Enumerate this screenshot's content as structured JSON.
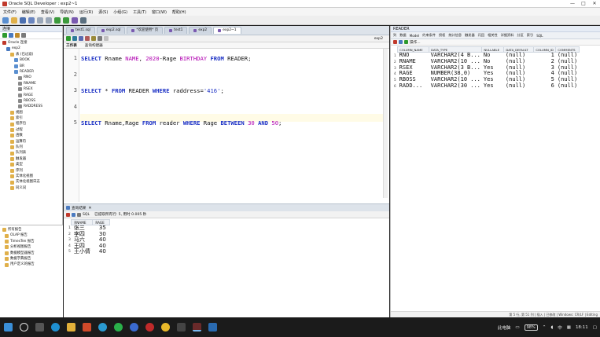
{
  "window": {
    "title": "Oracle SQL Developer : exp2~1",
    "controls": [
      "—",
      "□",
      "✕"
    ]
  },
  "menu": [
    "文件(F)",
    "编辑(E)",
    "查看(V)",
    "导航(N)",
    "运行(R)",
    "源(S)",
    "小组(G)",
    "工具(T)",
    "窗口(W)",
    "帮助(H)"
  ],
  "left_panel": {
    "title": "连接",
    "tree": [
      {
        "label": "Oracle 连接",
        "depth": 0
      },
      {
        "label": "exp2",
        "depth": 1
      },
      {
        "label": "表 (已过滤)",
        "depth": 2
      },
      {
        "label": "BOOK",
        "depth": 3
      },
      {
        "label": "BR",
        "depth": 3
      },
      {
        "label": "READER",
        "depth": 3
      },
      {
        "label": "RNO",
        "depth": 4
      },
      {
        "label": "RNAME",
        "depth": 4
      },
      {
        "label": "RSEX",
        "depth": 4
      },
      {
        "label": "RAGE",
        "depth": 4
      },
      {
        "label": "RBOSS",
        "depth": 4
      },
      {
        "label": "RADDRESS",
        "depth": 4
      },
      {
        "label": "视图",
        "depth": 2
      },
      {
        "label": "索引",
        "depth": 2
      },
      {
        "label": "程序包",
        "depth": 2
      },
      {
        "label": "过程",
        "depth": 2
      },
      {
        "label": "函数",
        "depth": 2
      },
      {
        "label": "运算符",
        "depth": 2
      },
      {
        "label": "队列",
        "depth": 2
      },
      {
        "label": "队列表",
        "depth": 2
      },
      {
        "label": "触发器",
        "depth": 2
      },
      {
        "label": "类型",
        "depth": 2
      },
      {
        "label": "序列",
        "depth": 2
      },
      {
        "label": "实体化视图",
        "depth": 2
      },
      {
        "label": "实体化视图日志",
        "depth": 2
      },
      {
        "label": "同义词",
        "depth": 2
      }
    ]
  },
  "reports_panel": {
    "items": [
      "所有报告",
      "OLAP 报告",
      "TimesTen 报告",
      "分析视图报告",
      "数据模型器报告",
      "数据字典报告",
      "用户定义的报告"
    ]
  },
  "editor": {
    "tabs": [
      "test1.sql",
      "exp2.sql",
      "*欢迎使用* 页",
      "test1",
      "exp2",
      "exp2~1"
    ],
    "active_tab": "exp2~1",
    "connection": "exp2",
    "subtabs": [
      "工作表",
      "查询构建器"
    ],
    "lines": [
      {
        "n": "1",
        "tokens": [
          [
            "kw",
            "SELECT"
          ],
          [
            "t",
            " Rname "
          ],
          [
            "num",
            "NAME"
          ],
          [
            "t",
            ", "
          ],
          [
            "num",
            "2020"
          ],
          [
            "t",
            "-Rage "
          ],
          [
            "num",
            "BIRTHDAY"
          ],
          [
            "t",
            " "
          ],
          [
            "kw",
            "FROM"
          ],
          [
            "t",
            " READER;"
          ]
        ]
      },
      {
        "n": "2",
        "tokens": []
      },
      {
        "n": "3",
        "tokens": [
          [
            "kw",
            "SELECT"
          ],
          [
            "t",
            " * "
          ],
          [
            "kw",
            "FROM"
          ],
          [
            "t",
            " READER "
          ],
          [
            "kw",
            "WHERE"
          ],
          [
            "t",
            " raddress="
          ],
          [
            "str",
            "'416'"
          ],
          [
            "t",
            ";"
          ]
        ]
      },
      {
        "n": "4",
        "tokens": []
      },
      {
        "n": "5",
        "tokens": [
          [
            "kw",
            "SELECT"
          ],
          [
            "t",
            " Rname,Rage "
          ],
          [
            "kw",
            "FROM"
          ],
          [
            "t",
            " reader "
          ],
          [
            "kw",
            "WHERE"
          ],
          [
            "t",
            " Rage "
          ],
          [
            "kw",
            "BETWEEN"
          ],
          [
            "t",
            " "
          ],
          [
            "num",
            "30"
          ],
          [
            "t",
            " "
          ],
          [
            "kw",
            "AND"
          ],
          [
            "t",
            " "
          ],
          [
            "num",
            "50"
          ],
          [
            "t",
            ";"
          ]
        ]
      }
    ]
  },
  "results": {
    "tab": "查询结果",
    "status": "已提取所有行: 5, 用时 0.005 秒",
    "sql_label": "SQL",
    "columns": [
      "RNAME",
      "RAGE"
    ],
    "rows": [
      {
        "rn": "1",
        "name": "张三",
        "age": "35"
      },
      {
        "rn": "2",
        "name": "李四",
        "age": "30"
      },
      {
        "rn": "3",
        "name": "马六",
        "age": "40"
      },
      {
        "rn": "4",
        "name": "王四",
        "age": "40"
      },
      {
        "rn": "5",
        "name": "王小倩",
        "age": "40"
      }
    ]
  },
  "right_panel": {
    "title": "READER",
    "tabs": [
      "列",
      "数据",
      "Model",
      "约束条件",
      "授权",
      "统计信息",
      "触发器",
      "闪回",
      "相关性",
      "详细资料",
      "分区",
      "索引",
      "SQL"
    ],
    "action": "操作...",
    "columns": [
      "COLUMN_NAME",
      "DATA_TYPE",
      "NULLABLE",
      "DATA_DEFAULT",
      "COLUMN_ID",
      "COMMENTS"
    ],
    "rows": [
      {
        "rn": "1",
        "name": "RNO",
        "type": "VARCHAR2(4 B...",
        "nullable": "No",
        "def": "(null)",
        "id": "1",
        "comments": "(null)"
      },
      {
        "rn": "2",
        "name": "RNAME",
        "type": "VARCHAR2(10 ...",
        "nullable": "No",
        "def": "(null)",
        "id": "2",
        "comments": "(null)"
      },
      {
        "rn": "3",
        "name": "RSEX",
        "type": "VARCHAR2(3 B...",
        "nullable": "Yes",
        "def": "(null)",
        "id": "3",
        "comments": "(null)"
      },
      {
        "rn": "4",
        "name": "RAGE",
        "type": "NUMBER(38,0)",
        "nullable": "Yes",
        "def": "(null)",
        "id": "4",
        "comments": "(null)"
      },
      {
        "rn": "5",
        "name": "RBOSS",
        "type": "VARCHAR2(10 ...",
        "nullable": "Yes",
        "def": "(null)",
        "id": "5",
        "comments": "(null)"
      },
      {
        "rn": "6",
        "name": "RADD...",
        "type": "VARCHAR2(30 ...",
        "nullable": "Yes",
        "def": "(null)",
        "id": "6",
        "comments": "(null)"
      }
    ],
    "status": "第 5 行, 第 51 列 | 插入 | 已修改 | Windows: CR/LF | Editing"
  },
  "taskbar": {
    "tray_text": "此电脑",
    "battery": "98%",
    "lang": "中",
    "time": "18:11"
  },
  "colors": {
    "keyword": "#1a2fc4",
    "number": "#b000b0",
    "panel_header": "#e6ecf5"
  }
}
